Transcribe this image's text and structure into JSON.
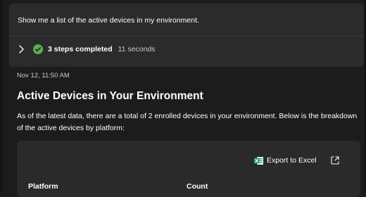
{
  "prompt": {
    "text": "Show me a list of the active devices in my environment."
  },
  "steps": {
    "label": "3 steps completed",
    "duration": "11 seconds",
    "status_color": "#54b054"
  },
  "response": {
    "timestamp": "Nov 12, 11:50 AM",
    "title": "Active Devices in Your Environment",
    "body": "As of the latest data, there are a total of 2 enrolled devices in your environment. Below is the breakdown of the active devices by platform:"
  },
  "table": {
    "export_label": "Export to Excel",
    "columns": [
      "Platform",
      "Count"
    ],
    "excel_color": "#21a366"
  },
  "icons": {
    "expand": "chevron-right-icon",
    "status": "check-circle-icon",
    "export": "excel-icon",
    "fullscreen": "expand-icon"
  }
}
